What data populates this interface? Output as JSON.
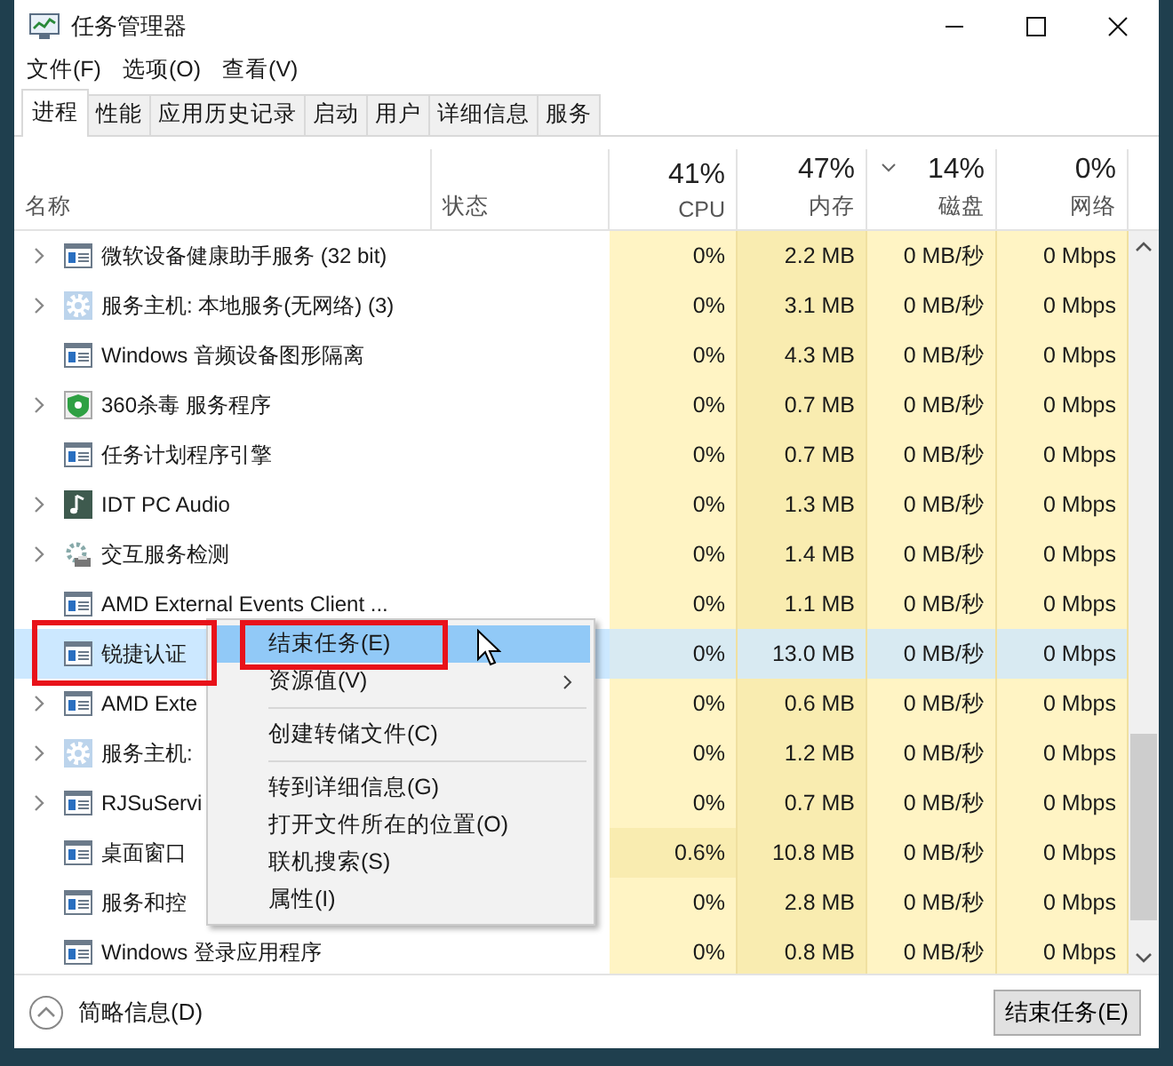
{
  "window": {
    "title": "任务管理器"
  },
  "menu": [
    "文件(F)",
    "选项(O)",
    "查看(V)"
  ],
  "tabs": [
    {
      "label": "进程",
      "selected": true
    },
    {
      "label": "性能",
      "selected": false
    },
    {
      "label": "应用历史记录",
      "selected": false
    },
    {
      "label": "启动",
      "selected": false
    },
    {
      "label": "用户",
      "selected": false
    },
    {
      "label": "详细信息",
      "selected": false
    },
    {
      "label": "服务",
      "selected": false
    }
  ],
  "columns": [
    {
      "label": "名称"
    },
    {
      "label": "状态"
    },
    {
      "label": "CPU",
      "total": "41%",
      "sorted": false
    },
    {
      "label": "内存",
      "total": "47%",
      "sorted": false
    },
    {
      "label": "磁盘",
      "total": "14%",
      "sorted": true
    },
    {
      "label": "网络",
      "total": "0%",
      "sorted": false
    }
  ],
  "rows": [
    {
      "name": "微软设备健康助手服务 (32 bit)",
      "expandable": true,
      "kind": "app",
      "cpu": "0%",
      "memory": "2.2 MB",
      "disk": "0 MB/秒",
      "network": "0 Mbps",
      "selected": false,
      "cpu_busy": false
    },
    {
      "name": "服务主机: 本地服务(无网络) (3)",
      "expandable": true,
      "kind": "gear",
      "cpu": "0%",
      "memory": "3.1 MB",
      "disk": "0 MB/秒",
      "network": "0 Mbps",
      "selected": false,
      "cpu_busy": false
    },
    {
      "name": "Windows 音频设备图形隔离",
      "expandable": false,
      "kind": "app",
      "cpu": "0%",
      "memory": "4.3 MB",
      "disk": "0 MB/秒",
      "network": "0 Mbps",
      "selected": false,
      "cpu_busy": false
    },
    {
      "name": "360杀毒 服务程序",
      "expandable": true,
      "kind": "shield",
      "cpu": "0%",
      "memory": "0.7 MB",
      "disk": "0 MB/秒",
      "network": "0 Mbps",
      "selected": false,
      "cpu_busy": false
    },
    {
      "name": "任务计划程序引擎",
      "expandable": false,
      "kind": "app",
      "cpu": "0%",
      "memory": "0.7 MB",
      "disk": "0 MB/秒",
      "network": "0 Mbps",
      "selected": false,
      "cpu_busy": false
    },
    {
      "name": "IDT PC Audio",
      "expandable": true,
      "kind": "music",
      "cpu": "0%",
      "memory": "1.3 MB",
      "disk": "0 MB/秒",
      "network": "0 Mbps",
      "selected": false,
      "cpu_busy": false
    },
    {
      "name": "交互服务检测",
      "expandable": true,
      "kind": "service",
      "cpu": "0%",
      "memory": "1.4 MB",
      "disk": "0 MB/秒",
      "network": "0 Mbps",
      "selected": false,
      "cpu_busy": false
    },
    {
      "name": "AMD External Events Client ...",
      "expandable": false,
      "kind": "app",
      "cpu": "0%",
      "memory": "1.1 MB",
      "disk": "0 MB/秒",
      "network": "0 Mbps",
      "selected": false,
      "cpu_busy": false
    },
    {
      "name": "锐捷认证",
      "expandable": false,
      "kind": "app",
      "cpu": "0%",
      "memory": "13.0 MB",
      "disk": "0 MB/秒",
      "network": "0 Mbps",
      "selected": true,
      "cpu_busy": false
    },
    {
      "name": "AMD Exte",
      "expandable": true,
      "kind": "app",
      "cpu": "0%",
      "memory": "0.6 MB",
      "disk": "0 MB/秒",
      "network": "0 Mbps",
      "selected": false,
      "cpu_busy": false
    },
    {
      "name": "服务主机:",
      "expandable": true,
      "kind": "gear",
      "cpu": "0%",
      "memory": "1.2 MB",
      "disk": "0 MB/秒",
      "network": "0 Mbps",
      "selected": false,
      "cpu_busy": false
    },
    {
      "name": "RJSuServi",
      "expandable": true,
      "kind": "app",
      "cpu": "0%",
      "memory": "0.7 MB",
      "disk": "0 MB/秒",
      "network": "0 Mbps",
      "selected": false,
      "cpu_busy": false
    },
    {
      "name": "桌面窗口",
      "expandable": false,
      "kind": "app",
      "cpu": "0.6%",
      "memory": "10.8 MB",
      "disk": "0 MB/秒",
      "network": "0 Mbps",
      "selected": false,
      "cpu_busy": true
    },
    {
      "name": "服务和控",
      "expandable": false,
      "kind": "app",
      "cpu": "0%",
      "memory": "2.8 MB",
      "disk": "0 MB/秒",
      "network": "0 Mbps",
      "selected": false,
      "cpu_busy": false
    },
    {
      "name": "Windows 登录应用程序",
      "expandable": false,
      "kind": "app",
      "cpu": "0%",
      "memory": "0.8 MB",
      "disk": "0 MB/秒",
      "network": "0 Mbps",
      "selected": false,
      "cpu_busy": false
    }
  ],
  "context_menu": [
    {
      "kind": "item",
      "label": "结束任务(E)",
      "hovered": true,
      "submenu": false
    },
    {
      "kind": "item",
      "label": "资源值(V)",
      "hovered": false,
      "submenu": true
    },
    {
      "kind": "separator"
    },
    {
      "kind": "item",
      "label": "创建转储文件(C)",
      "hovered": false,
      "submenu": false
    },
    {
      "kind": "separator"
    },
    {
      "kind": "item",
      "label": "转到详细信息(G)",
      "hovered": false,
      "submenu": false
    },
    {
      "kind": "item",
      "label": "打开文件所在的位置(O)",
      "hovered": false,
      "submenu": false
    },
    {
      "kind": "item",
      "label": "联机搜索(S)",
      "hovered": false,
      "submenu": false
    },
    {
      "kind": "item",
      "label": "属性(I)",
      "hovered": false,
      "submenu": false
    }
  ],
  "footer": {
    "details_toggle": "简略信息(D)",
    "end_task_button": "结束任务(E)"
  }
}
